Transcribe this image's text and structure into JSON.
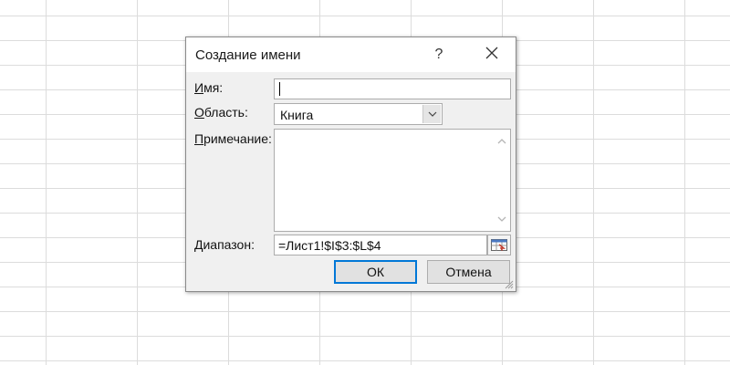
{
  "dialog": {
    "title": "Создание имени",
    "help_label": "?",
    "close_icon": "close-icon"
  },
  "fields": {
    "name": {
      "label_accel": "И",
      "label_rest": "мя:",
      "value": ""
    },
    "scope": {
      "label_accel": "О",
      "label_rest": "бласть:",
      "value": "Книга"
    },
    "comment": {
      "label_accel": "П",
      "label_rest": "римечание:",
      "value": ""
    },
    "range": {
      "label": "Диапазон:",
      "value": "=Лист1!$I$3:$L$4"
    }
  },
  "buttons": {
    "ok_label": "ОК",
    "cancel_label": "Отмена"
  },
  "colors": {
    "accent": "#0078d7",
    "dialog_bg": "#f0f0f0",
    "gridline": "#dcdcdc"
  }
}
